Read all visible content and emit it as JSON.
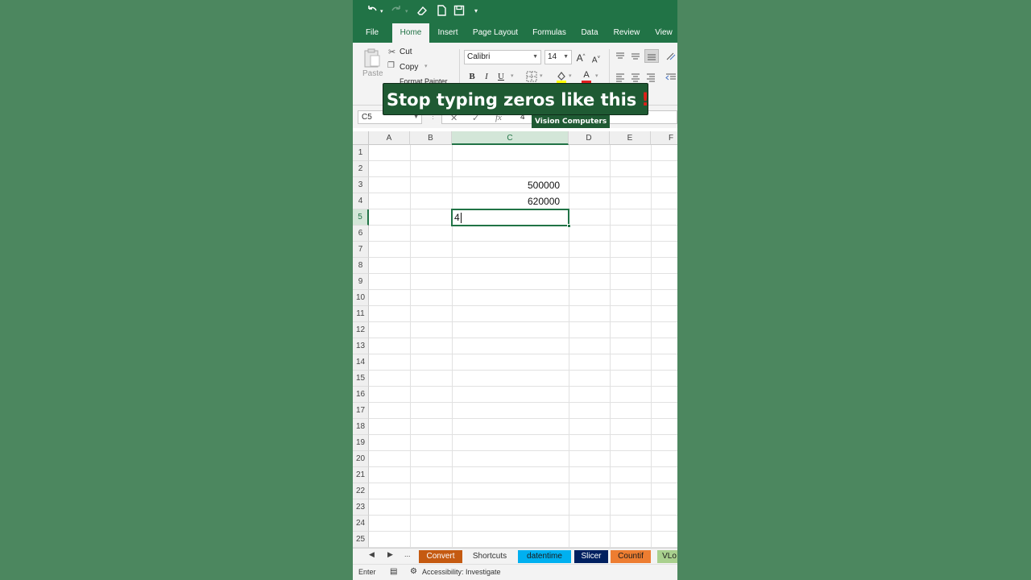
{
  "quick_access": {
    "undo_icon": "undo-icon",
    "redo_icon": "redo-icon",
    "eraser_icon": "eraser-icon",
    "new_doc_icon": "new-document-icon",
    "save_icon": "save-icon",
    "customize_icon": "customize-quick-access-icon"
  },
  "tabs": [
    "File",
    "Home",
    "Insert",
    "Page Layout",
    "Formulas",
    "Data",
    "Review",
    "View"
  ],
  "active_tab": "Home",
  "ribbon": {
    "paste_label": "Paste",
    "cut_label": "Cut",
    "copy_label": "Copy",
    "format_painter_label": "Format Painter",
    "font_name": "Calibri",
    "font_size": "14",
    "grow_font_label": "A",
    "shrink_font_label": "A",
    "bold_label": "B",
    "italic_label": "I",
    "underline_label": "U",
    "font_color_label": "A"
  },
  "formula_bar": {
    "name_box": "C5",
    "cancel_symbol": "✕",
    "enter_symbol": "✓",
    "fx_symbol": "fx",
    "value": "4"
  },
  "sheet": {
    "columns": [
      "A",
      "B",
      "C",
      "D",
      "E",
      "F"
    ],
    "selected_column": "C",
    "rows": [
      "1",
      "2",
      "3",
      "4",
      "5",
      "6",
      "7",
      "8",
      "9",
      "10",
      "11",
      "12",
      "13",
      "14",
      "15",
      "16",
      "17",
      "18",
      "19",
      "20",
      "21",
      "22",
      "23",
      "24",
      "25"
    ],
    "selected_row": "5",
    "cells": {
      "C3": "500000",
      "C4": "620000",
      "C5": "4"
    }
  },
  "sheet_tabs": [
    {
      "label": "Convert",
      "bg": "#c55a11",
      "fg": "#ffffff"
    },
    {
      "label": "Shortcuts",
      "bg": "#f3f3f3",
      "fg": "#333333"
    },
    {
      "label": "datentime",
      "bg": "#00b0f0",
      "fg": "#1a1a1a"
    },
    {
      "label": "Slicer",
      "bg": "#002060",
      "fg": "#ffffff"
    },
    {
      "label": "Countif",
      "bg": "#ed7d31",
      "fg": "#1a1a1a"
    },
    {
      "label": "VLo",
      "bg": "#a9d08e",
      "fg": "#1a1a1a"
    }
  ],
  "sheet_nav": {
    "prev": "◀",
    "next": "▶",
    "more": "..."
  },
  "status": {
    "mode": "Enter",
    "accessibility": "Accessibility: Investigate"
  },
  "overlay": {
    "headline": "Stop typing zeros like this",
    "headline_emoji": "‼",
    "brand": "Vision Computers"
  },
  "colors": {
    "excel_green": "#217346",
    "background": "#4c875f",
    "headline_bg": "#1f5a33"
  }
}
